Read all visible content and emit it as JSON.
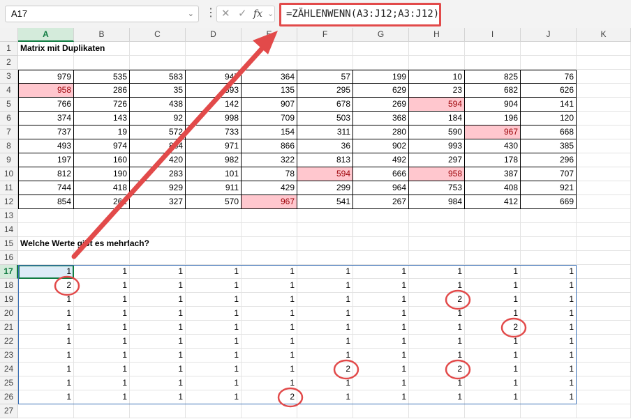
{
  "namebox": {
    "value": "A17"
  },
  "formula_bar": {
    "fx_label": "fx",
    "formula": "=ZÄHLENWENN(A3:J12;A3:J12)"
  },
  "columns": [
    "A",
    "B",
    "C",
    "D",
    "E",
    "F",
    "G",
    "H",
    "I",
    "J",
    "K"
  ],
  "rows": [
    "1",
    "2",
    "3",
    "4",
    "5",
    "6",
    "7",
    "8",
    "9",
    "10",
    "11",
    "12",
    "13",
    "14",
    "15",
    "16",
    "17",
    "18",
    "19",
    "20",
    "21",
    "22",
    "23",
    "24",
    "25",
    "26",
    "27"
  ],
  "selected_column": "A",
  "selected_row": "17",
  "titles": {
    "matrix": "Matrix mit Duplikaten",
    "question": "Welche Werte gibt es mehrfach?"
  },
  "matrix": [
    [
      979,
      535,
      583,
      947,
      364,
      57,
      199,
      10,
      825,
      76
    ],
    [
      958,
      286,
      35,
      593,
      135,
      295,
      629,
      23,
      682,
      626
    ],
    [
      766,
      726,
      438,
      142,
      907,
      678,
      269,
      594,
      904,
      141
    ],
    [
      374,
      143,
      92,
      998,
      709,
      503,
      368,
      184,
      196,
      120
    ],
    [
      737,
      19,
      572,
      733,
      154,
      311,
      280,
      590,
      967,
      668
    ],
    [
      493,
      974,
      864,
      971,
      866,
      36,
      902,
      993,
      430,
      385
    ],
    [
      197,
      160,
      420,
      982,
      322,
      813,
      492,
      297,
      178,
      296
    ],
    [
      812,
      190,
      283,
      101,
      78,
      594,
      666,
      958,
      387,
      707
    ],
    [
      744,
      418,
      929,
      911,
      429,
      299,
      964,
      753,
      408,
      921
    ],
    [
      854,
      261,
      327,
      570,
      967,
      541,
      267,
      984,
      412,
      669
    ]
  ],
  "duplicates": [
    [
      1,
      0
    ],
    [
      2,
      7
    ],
    [
      4,
      8
    ],
    [
      7,
      5
    ],
    [
      7,
      7
    ],
    [
      9,
      4
    ]
  ],
  "counts": [
    [
      1,
      1,
      1,
      1,
      1,
      1,
      1,
      1,
      1,
      1
    ],
    [
      2,
      1,
      1,
      1,
      1,
      1,
      1,
      1,
      1,
      1
    ],
    [
      1,
      1,
      1,
      1,
      1,
      1,
      1,
      2,
      1,
      1
    ],
    [
      1,
      1,
      1,
      1,
      1,
      1,
      1,
      1,
      1,
      1
    ],
    [
      1,
      1,
      1,
      1,
      1,
      1,
      1,
      1,
      2,
      1
    ],
    [
      1,
      1,
      1,
      1,
      1,
      1,
      1,
      1,
      1,
      1
    ],
    [
      1,
      1,
      1,
      1,
      1,
      1,
      1,
      1,
      1,
      1
    ],
    [
      1,
      1,
      1,
      1,
      1,
      2,
      1,
      2,
      1,
      1
    ],
    [
      1,
      1,
      1,
      1,
      1,
      1,
      1,
      1,
      1,
      1
    ],
    [
      1,
      1,
      1,
      1,
      2,
      1,
      1,
      1,
      1,
      1
    ]
  ],
  "colors": {
    "annotation_red": "#e24a4a",
    "duplicate_fill": "#ffc7ce",
    "duplicate_text": "#9c0006",
    "selection_green": "#107c41"
  }
}
